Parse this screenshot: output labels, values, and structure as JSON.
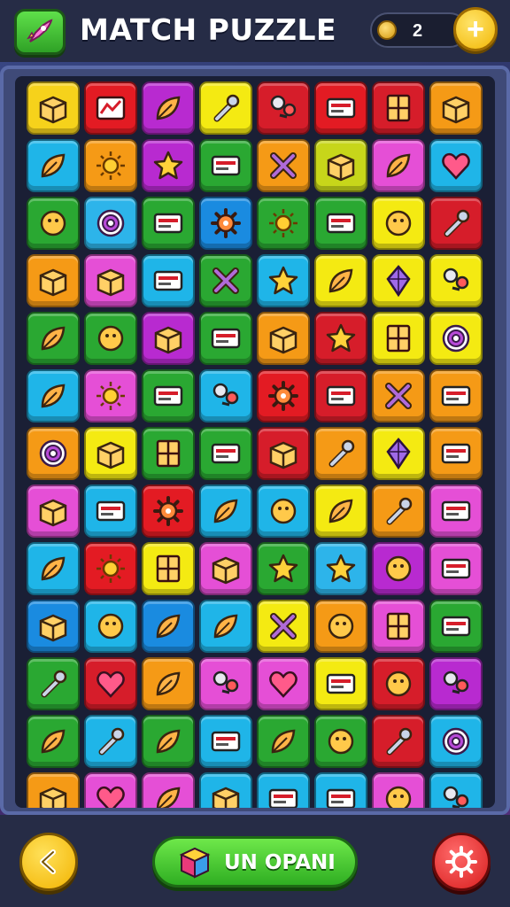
{
  "header": {
    "title": "MATCH PUZZLE",
    "coins": "2",
    "add_coins_label": "+"
  },
  "footer": {
    "undo_label": "UN OPANI"
  },
  "board": {
    "rows": 13,
    "cols": 8,
    "tiles": [
      [
        "#f6d21b",
        "box-icon"
      ],
      [
        "#e31b23",
        "chart-icon"
      ],
      [
        "#b82ad0",
        "leaf-icon"
      ],
      [
        "#f4ea12",
        "wrench-icon"
      ],
      [
        "#d61d2a",
        "tool-icon"
      ],
      [
        "#e31b23",
        "card-icon"
      ],
      [
        "#d61d2a",
        "window-icon"
      ],
      [
        "#f59a16",
        "box-icon"
      ],
      [
        "#1fb5e8",
        "leaf-icon"
      ],
      [
        "#f59a16",
        "sun-icon"
      ],
      [
        "#b82ad0",
        "star-icon"
      ],
      [
        "#2aa832",
        "card-icon"
      ],
      [
        "#f59a16",
        "cross-icon"
      ],
      [
        "#c7d61a",
        "box-icon"
      ],
      [
        "#e54fd6",
        "leaf-icon"
      ],
      [
        "#1fb5e8",
        "heart-icon"
      ],
      [
        "#2aa832",
        "circle-icon"
      ],
      [
        "#2db4ea",
        "target-icon"
      ],
      [
        "#2aa832",
        "card-icon"
      ],
      [
        "#1a8be0",
        "gear-icon"
      ],
      [
        "#2aa832",
        "sun-icon"
      ],
      [
        "#2aa832",
        "card-icon"
      ],
      [
        "#f4ea12",
        "circle-icon"
      ],
      [
        "#d61d2a",
        "wrench-icon"
      ],
      [
        "#f59a16",
        "box-icon"
      ],
      [
        "#e54fd6",
        "box-icon"
      ],
      [
        "#1fb5e8",
        "card-icon"
      ],
      [
        "#2aa832",
        "cross-icon"
      ],
      [
        "#1fb5e8",
        "star-icon"
      ],
      [
        "#f4ea12",
        "leaf-icon"
      ],
      [
        "#f4ea12",
        "diamond-icon"
      ],
      [
        "#f4ea12",
        "tool-icon"
      ],
      [
        "#2aa832",
        "leaf-icon"
      ],
      [
        "#2aa832",
        "circle-icon"
      ],
      [
        "#b82ad0",
        "box-icon"
      ],
      [
        "#2aa832",
        "card-icon"
      ],
      [
        "#f59a16",
        "box-icon"
      ],
      [
        "#d61d2a",
        "star-icon"
      ],
      [
        "#f4ea12",
        "window-icon"
      ],
      [
        "#f4ea12",
        "target-icon"
      ],
      [
        "#1fb5e8",
        "leaf-icon"
      ],
      [
        "#e54fd6",
        "sun-icon"
      ],
      [
        "#2aa832",
        "card-icon"
      ],
      [
        "#1fb5e8",
        "tool-icon"
      ],
      [
        "#e31b23",
        "gear-icon"
      ],
      [
        "#d61d2a",
        "card-icon"
      ],
      [
        "#f59a16",
        "cross-icon"
      ],
      [
        "#f59a16",
        "card-icon"
      ],
      [
        "#f59a16",
        "target-icon"
      ],
      [
        "#f4ea12",
        "box-icon"
      ],
      [
        "#2aa832",
        "window-icon"
      ],
      [
        "#2aa832",
        "card-icon"
      ],
      [
        "#d61d2a",
        "box-icon"
      ],
      [
        "#f59a16",
        "wrench-icon"
      ],
      [
        "#f4ea12",
        "diamond-icon"
      ],
      [
        "#f59a16",
        "card-icon"
      ],
      [
        "#e54fd6",
        "box-icon"
      ],
      [
        "#1fb5e8",
        "card-icon"
      ],
      [
        "#e31b23",
        "gear-icon"
      ],
      [
        "#1fb5e8",
        "leaf-icon"
      ],
      [
        "#1fb5e8",
        "circle-icon"
      ],
      [
        "#f4ea12",
        "leaf-icon"
      ],
      [
        "#f59a16",
        "wrench-icon"
      ],
      [
        "#e54fd6",
        "card-icon"
      ],
      [
        "#1fb5e8",
        "leaf-icon"
      ],
      [
        "#e31b23",
        "sun-icon"
      ],
      [
        "#f4ea12",
        "window-icon"
      ],
      [
        "#e54fd6",
        "box-icon"
      ],
      [
        "#2aa832",
        "star-icon"
      ],
      [
        "#2db4ea",
        "star-icon"
      ],
      [
        "#b82ad0",
        "circle-icon"
      ],
      [
        "#e54fd6",
        "card-icon"
      ],
      [
        "#1a8be0",
        "box-icon"
      ],
      [
        "#1fb5e8",
        "circle-icon"
      ],
      [
        "#1a8be0",
        "leaf-icon"
      ],
      [
        "#1fb5e8",
        "leaf-icon"
      ],
      [
        "#f4ea12",
        "cross-icon"
      ],
      [
        "#f59a16",
        "circle-icon"
      ],
      [
        "#e54fd6",
        "window-icon"
      ],
      [
        "#2aa832",
        "card-icon"
      ],
      [
        "#2aa832",
        "wrench-icon"
      ],
      [
        "#d61d2a",
        "heart-icon"
      ],
      [
        "#f59a16",
        "leaf-icon"
      ],
      [
        "#e54fd6",
        "tool-icon"
      ],
      [
        "#e54fd6",
        "heart-icon"
      ],
      [
        "#f4ea12",
        "card-icon"
      ],
      [
        "#d61d2a",
        "circle-icon"
      ],
      [
        "#b82ad0",
        "tool-icon"
      ],
      [
        "#2aa832",
        "leaf-icon"
      ],
      [
        "#1fb5e8",
        "wrench-icon"
      ],
      [
        "#2aa832",
        "leaf-icon"
      ],
      [
        "#1fb5e8",
        "card-icon"
      ],
      [
        "#2aa832",
        "leaf-icon"
      ],
      [
        "#2aa832",
        "circle-icon"
      ],
      [
        "#d61d2a",
        "wrench-icon"
      ],
      [
        "#1fb5e8",
        "target-icon"
      ],
      [
        "#f59a16",
        "box-icon"
      ],
      [
        "#e54fd6",
        "heart-icon"
      ],
      [
        "#e54fd6",
        "leaf-icon"
      ],
      [
        "#1fb5e8",
        "box-icon"
      ],
      [
        "#1fb5e8",
        "card-icon"
      ],
      [
        "#1fb5e8",
        "card-icon"
      ],
      [
        "#e54fd6",
        "circle-icon"
      ],
      [
        "#1fb5e8",
        "tool-icon"
      ]
    ]
  }
}
